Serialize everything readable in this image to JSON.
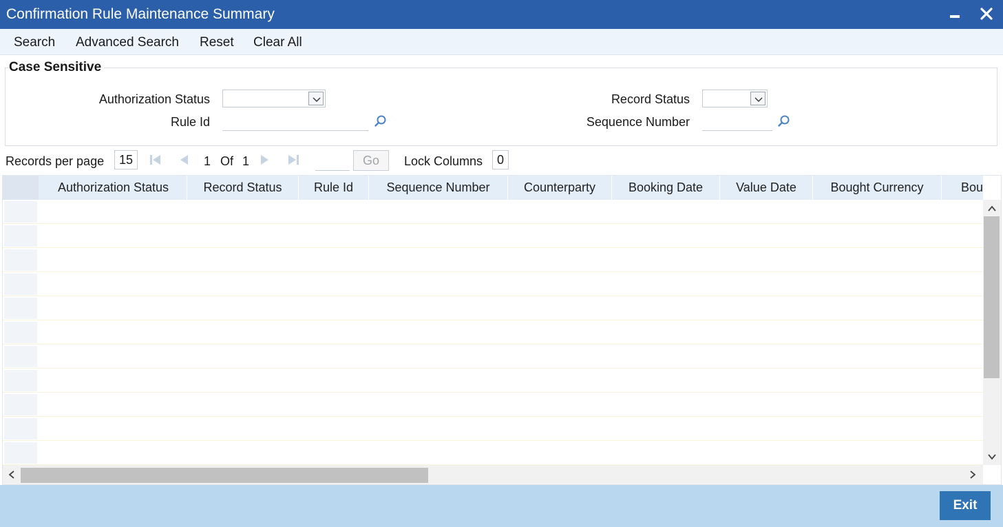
{
  "window": {
    "title": "Confirmation Rule Maintenance Summary"
  },
  "menu": {
    "items": [
      "Search",
      "Advanced Search",
      "Reset",
      "Clear All"
    ]
  },
  "criteria": {
    "legend": "Case Sensitive",
    "authorization_status_label": "Authorization Status",
    "authorization_status_value": "",
    "record_status_label": "Record Status",
    "record_status_value": "",
    "rule_id_label": "Rule Id",
    "rule_id_value": "",
    "sequence_number_label": "Sequence Number",
    "sequence_number_value": ""
  },
  "pager": {
    "records_per_page_label": "Records per page",
    "records_per_page": "15",
    "current_page": "1",
    "of_label": "Of",
    "total_pages": "1",
    "go_label": "Go",
    "lock_columns_label": "Lock Columns",
    "lock_columns": "0"
  },
  "grid": {
    "columns": [
      "Authorization Status",
      "Record Status",
      "Rule Id",
      "Sequence Number",
      "Counterparty",
      "Booking Date",
      "Value Date",
      "Bought Currency",
      "Bou"
    ],
    "rows": []
  },
  "footer": {
    "exit_label": "Exit"
  },
  "colors": {
    "titlebar": "#2b5faa",
    "footer": "#b9d7ee",
    "exit_button": "#2f74b5",
    "header_row": "#e4eef9"
  }
}
